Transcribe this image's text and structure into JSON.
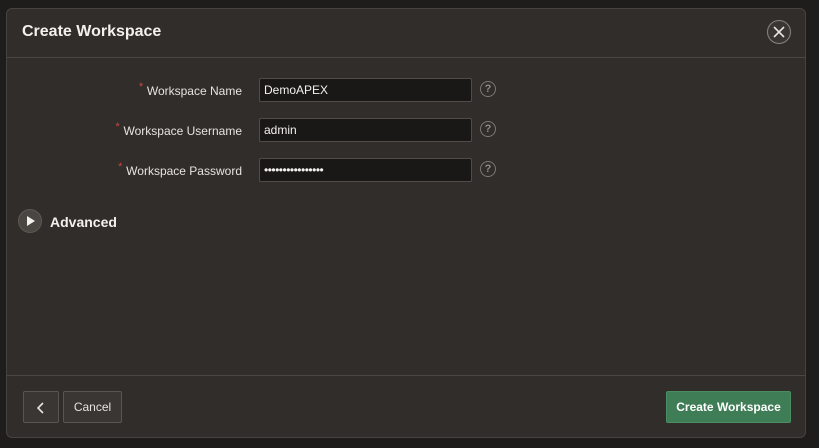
{
  "dialog": {
    "title": "Create Workspace",
    "close_icon": "close-icon"
  },
  "form": {
    "fields": [
      {
        "label": "Workspace Name",
        "required_mark": "*",
        "value": "DemoAPEX",
        "help": "?"
      },
      {
        "label": "Workspace Username",
        "required_mark": "*",
        "value": "admin",
        "help": "?"
      },
      {
        "label": "Workspace Password",
        "required_mark": "*",
        "value": "••••••••••••••••",
        "help": "?"
      }
    ],
    "advanced_label": "Advanced"
  },
  "footer": {
    "back_icon": "chevron-left-icon",
    "cancel_label": "Cancel",
    "create_label": "Create Workspace"
  },
  "colors": {
    "primary_button": "#3f7d56",
    "required_mark": "#c9473a",
    "dialog_bg": "#312d2a"
  }
}
